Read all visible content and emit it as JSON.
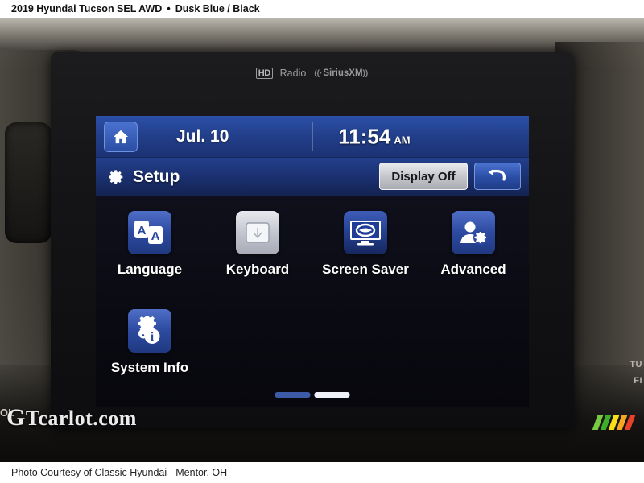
{
  "caption": {
    "vehicle": "2019 Hyundai Tucson SEL AWD",
    "separator": "•",
    "colors": "Dusk Blue / Black",
    "footer": "Photo Courtesy of Classic Hyundai - Mentor, OH"
  },
  "headunit": {
    "brand_hd_box": "HD",
    "brand_hd_text": "Radio",
    "sirius_wave": "((·",
    "sirius_text": "SiriusXM",
    "sirius_suffix": "))",
    "dash_text_right_1": "TU",
    "dash_text_right_2": "FI",
    "dash_text_left_1": "OL"
  },
  "screen": {
    "status": {
      "home_icon": "home-icon",
      "date": "Jul. 10",
      "time": "11:54",
      "ampm": "AM"
    },
    "titlebar": {
      "gear_icon": "gear-icon",
      "title": "Setup",
      "display_off_label": "Display Off",
      "back_icon": "back-arrow-icon"
    },
    "menu": {
      "items": [
        {
          "label": "Language",
          "icon": "language-aa-icon"
        },
        {
          "label": "Keyboard",
          "icon": "keyboard-icon"
        },
        {
          "label": "Screen Saver",
          "icon": "screen-saver-icon"
        },
        {
          "label": "Advanced",
          "icon": "advanced-user-gear-icon"
        },
        {
          "label": "System Info",
          "icon": "system-info-gear-icon"
        }
      ],
      "pages": {
        "count": 2,
        "active_index": 1
      }
    },
    "colors": {
      "status_blue": "#23408c",
      "title_blue": "#1a2f6d",
      "accent_white": "#ffffff",
      "tile_blue": "#2d4aa0",
      "page_active": "#eef1f8",
      "page_inactive": "#3d5aa6"
    }
  },
  "watermark": {
    "g": "G",
    "text": "Tcarlot.com",
    "bar_colors": [
      "#7ac943",
      "#3fae2a",
      "#f7e017",
      "#f5a623",
      "#e8412a"
    ]
  }
}
